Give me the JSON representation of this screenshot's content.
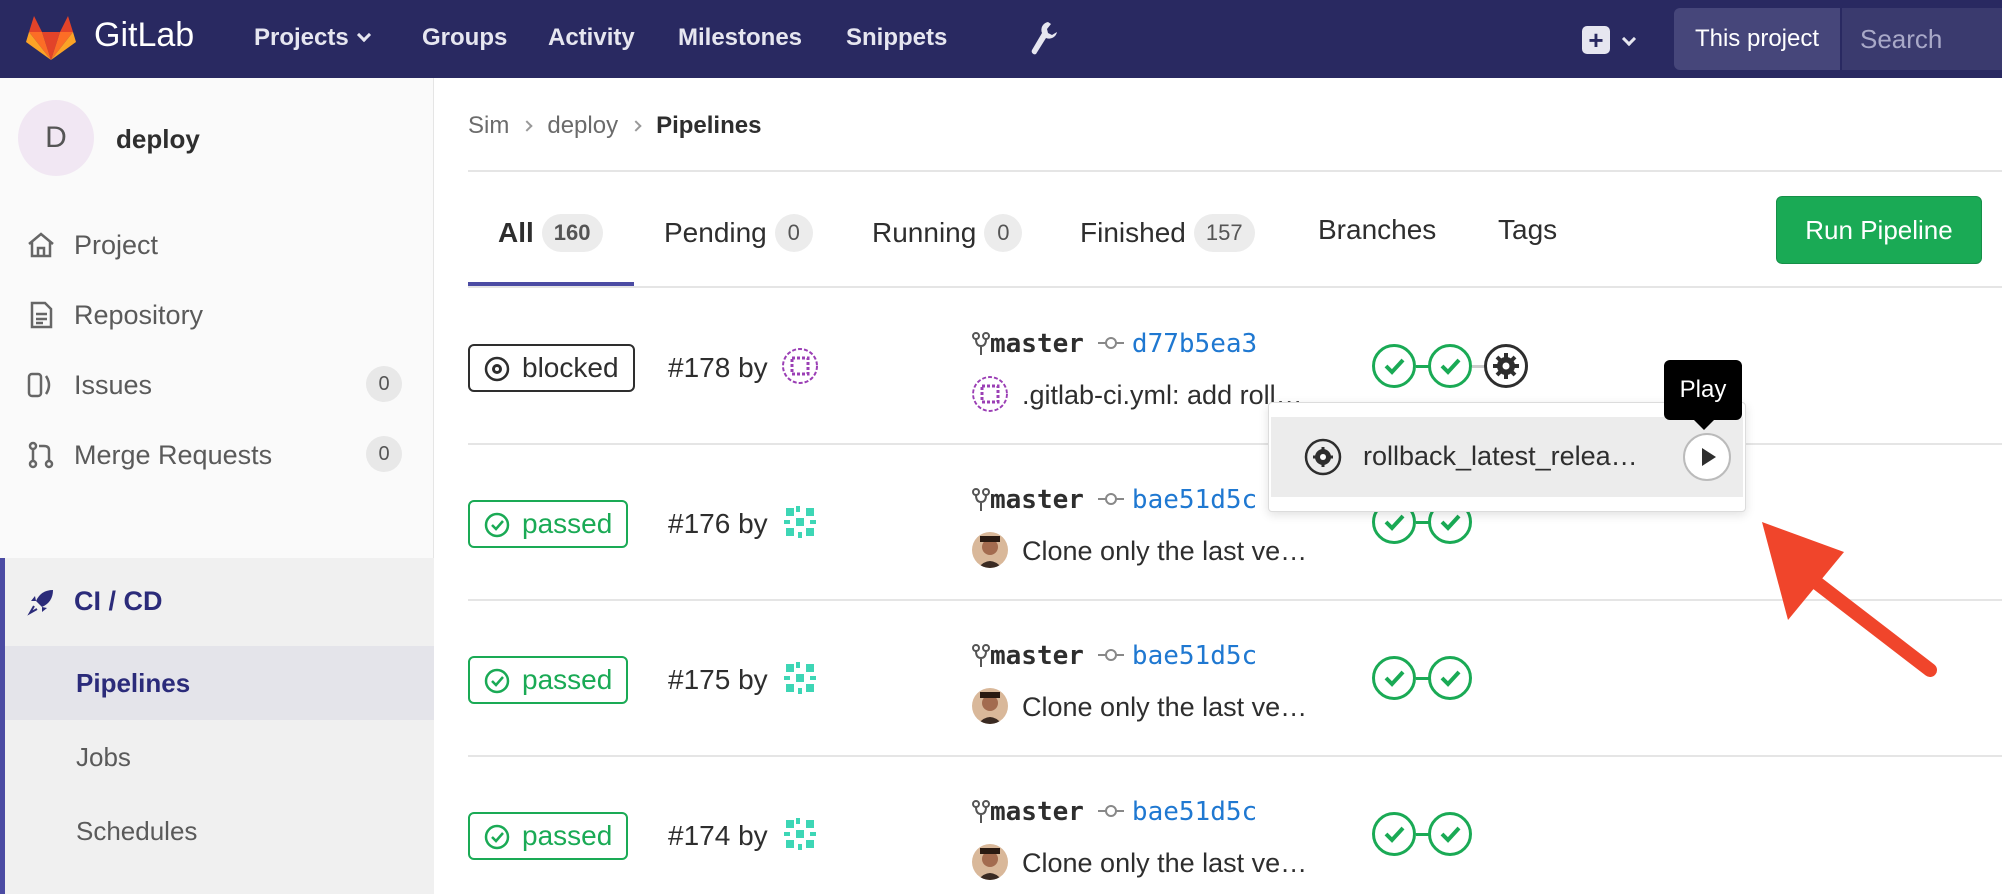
{
  "topnav": {
    "brand": "GitLab",
    "links": [
      "Projects",
      "Groups",
      "Activity",
      "Milestones",
      "Snippets"
    ],
    "search_scope": "This project",
    "search_placeholder": "Search",
    "brand_color": "#292961"
  },
  "sidebar": {
    "project_initial": "D",
    "project_name": "deploy",
    "items": [
      {
        "label": "Project",
        "icon": "home-icon"
      },
      {
        "label": "Repository",
        "icon": "document-icon"
      },
      {
        "label": "Issues",
        "icon": "issues-icon",
        "count": "0"
      },
      {
        "label": "Merge Requests",
        "icon": "merge-request-icon",
        "count": "0"
      }
    ],
    "ci": {
      "label": "CI / CD",
      "icon": "rocket-icon",
      "sub": [
        "Pipelines",
        "Jobs",
        "Schedules"
      ]
    }
  },
  "breadcrumb": [
    "Sim",
    "deploy",
    "Pipelines"
  ],
  "tabs": [
    {
      "label": "All",
      "count": "160"
    },
    {
      "label": "Pending",
      "count": "0"
    },
    {
      "label": "Running",
      "count": "0"
    },
    {
      "label": "Finished",
      "count": "157"
    },
    {
      "label": "Branches"
    },
    {
      "label": "Tags"
    }
  ],
  "run_button": "Run Pipeline",
  "pipelines": [
    {
      "status": "blocked",
      "id": "#178 by",
      "branch": "master",
      "sha": "d77b5ea3",
      "commit": ".gitlab-ci.yml: add roll…",
      "stages": [
        "passed",
        "passed",
        "manual"
      ]
    },
    {
      "status": "passed",
      "id": "#176 by",
      "branch": "master",
      "sha": "bae51d5c",
      "commit": "Clone only the last ve…",
      "stages": [
        "passed",
        "passed"
      ]
    },
    {
      "status": "passed",
      "id": "#175 by",
      "branch": "master",
      "sha": "bae51d5c",
      "commit": "Clone only the last ve…",
      "stages": [
        "passed",
        "passed"
      ]
    },
    {
      "status": "passed",
      "id": "#174 by",
      "branch": "master",
      "sha": "bae51d5c",
      "commit": "Clone only the last ve…",
      "stages": [
        "passed",
        "passed"
      ]
    }
  ],
  "dropdown": {
    "job": "rollback_latest_relea…",
    "tooltip": "Play"
  },
  "colors": {
    "success": "#1aaa55",
    "link": "#1f78d1",
    "accent": "#4b4ba3",
    "annotation_arrow": "#f0452b"
  }
}
